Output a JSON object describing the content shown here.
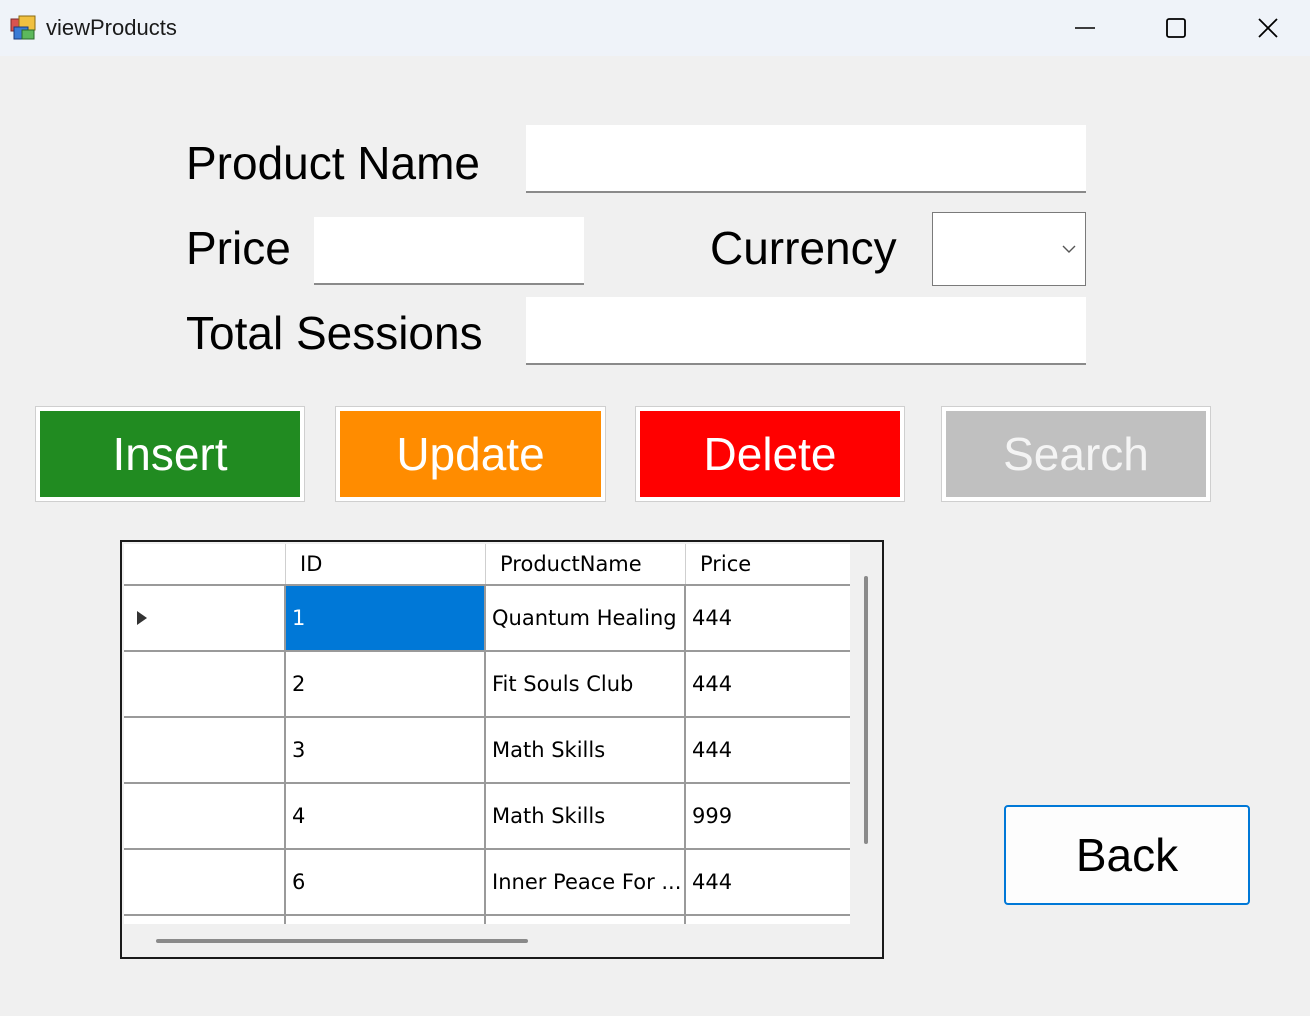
{
  "window": {
    "title": "viewProducts"
  },
  "icons": {
    "app": "app-icon",
    "minimize": "minimize-icon",
    "maximize": "maximize-icon",
    "close": "close-icon",
    "dropdown": "chevron-down-icon",
    "row_selector": "row-indicator-icon"
  },
  "form": {
    "product_name_label": "Product Name",
    "product_name_value": "",
    "price_label": "Price",
    "price_value": "",
    "currency_label": "Currency",
    "currency_value": "",
    "total_sessions_label": "Total Sessions",
    "total_sessions_value": ""
  },
  "buttons": {
    "insert": "Insert",
    "update": "Update",
    "delete": "Delete",
    "search": "Search",
    "back": "Back"
  },
  "colors": {
    "insert": "#218b21",
    "update": "#ff8c00",
    "delete": "#ff0000",
    "search_disabled": "#c0c0c0",
    "selection": "#0078d7"
  },
  "grid": {
    "columns": [
      "",
      "ID",
      "ProductName",
      "Price"
    ],
    "rows": [
      {
        "id": "1",
        "name": "Quantum Healing",
        "price": "444"
      },
      {
        "id": "2",
        "name": "Fit Souls Club",
        "price": "444"
      },
      {
        "id": "3",
        "name": "Math Skills",
        "price": "444"
      },
      {
        "id": "4",
        "name": "Math Skills",
        "price": "999"
      },
      {
        "id": "6",
        "name": "Inner Peace For ...",
        "price": "444"
      }
    ]
  }
}
